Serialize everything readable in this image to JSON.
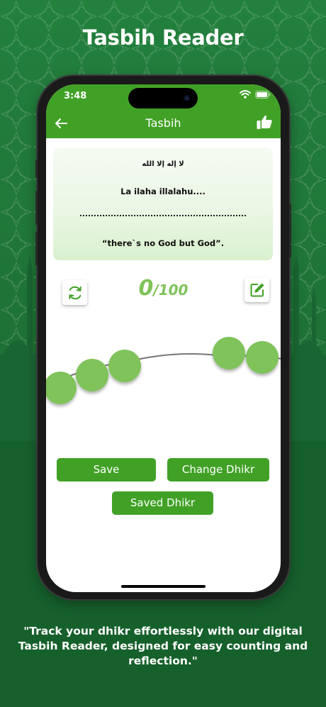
{
  "headline": "Tasbih Reader",
  "status_bar": {
    "time": "3:48"
  },
  "nav": {
    "title": "Tasbih",
    "back_icon": "arrow-left-icon",
    "action_icon": "thumbs-up-icon"
  },
  "dhikr": {
    "arabic": "لا إله إلا الله",
    "transliteration": "La ilaha illalahu....",
    "meaning": "“there`s no God but God”."
  },
  "counter": {
    "count": "0",
    "separator": "/",
    "total": "100"
  },
  "controls": {
    "reset_icon": "refresh-icon",
    "edit_icon": "edit-icon"
  },
  "buttons": {
    "save": "Save",
    "change_dhikr": "Change Dhikr",
    "saved_dhikr": "Saved Dhikr"
  },
  "tagline": "\"Track your dhikr effortlessly with our digital Tasbih Reader, designed for easy counting and reflection.\"",
  "colors": {
    "primary_green": "#41a126",
    "bead_green": "#7fc35a",
    "background_green": "#1c6d34"
  }
}
